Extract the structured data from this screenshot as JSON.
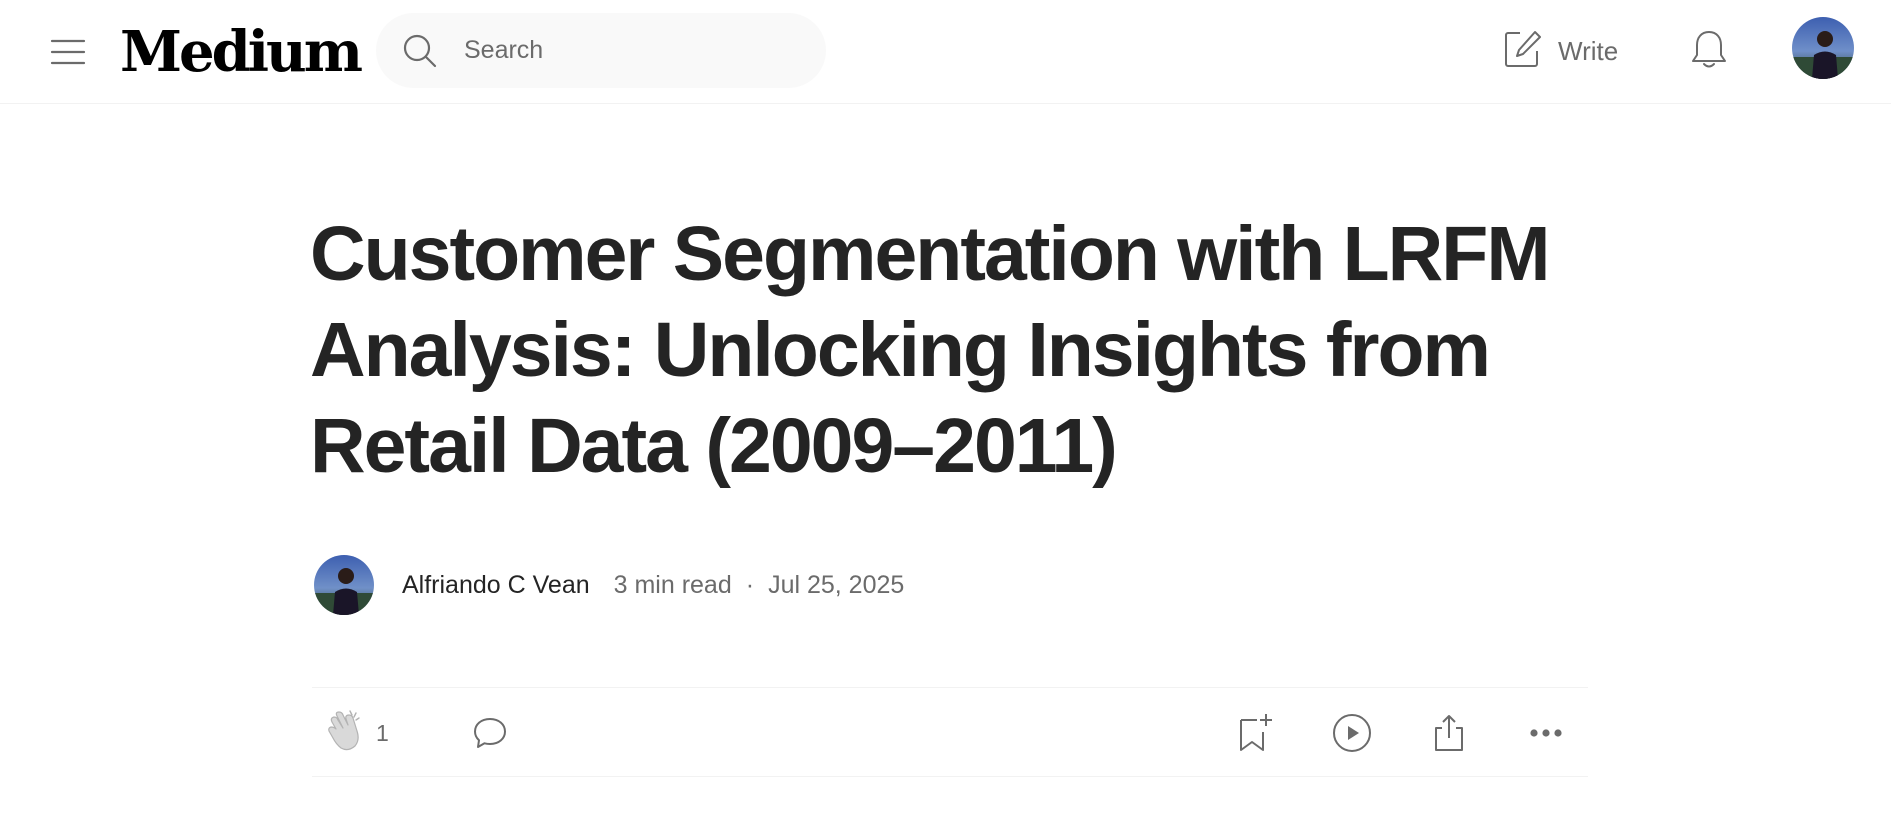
{
  "header": {
    "logo": "Medium",
    "search": {
      "placeholder": "Search",
      "value": ""
    },
    "write_label": "Write",
    "icons": {
      "menu": "hamburger-menu-icon",
      "search": "search-icon",
      "write": "write-icon",
      "notifications": "bell-icon"
    }
  },
  "article": {
    "title": "Customer Segmentation with LRFM Analysis: Unlocking Insights from Retail Data (2009–2011)",
    "author": "Alfriando C Vean",
    "read_time": "3 min read",
    "separator": "·",
    "date": "Jul 25, 2025"
  },
  "actions": {
    "clap_count": "1",
    "icons": [
      "clap-icon",
      "comment-icon",
      "bookmark-add-icon",
      "play-icon",
      "share-icon",
      "more-icon"
    ]
  },
  "colors": {
    "text_primary": "#242424",
    "text_secondary": "#6b6b6b",
    "search_bg": "#f9f9f9",
    "divider": "#f2f2f2"
  }
}
